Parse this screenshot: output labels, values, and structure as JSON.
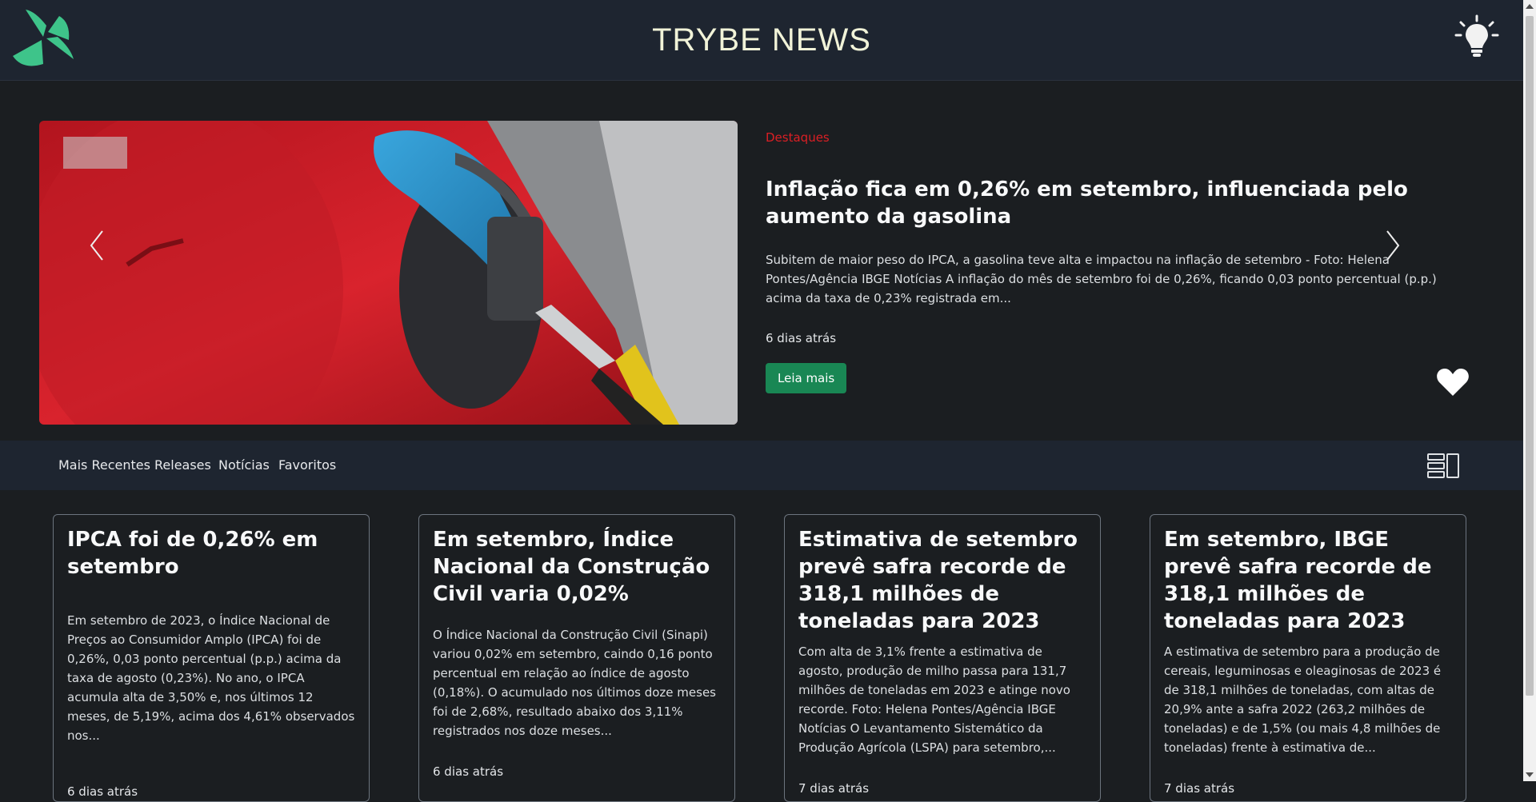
{
  "header": {
    "title": "TRYBE NEWS",
    "logo_icon": "trybe-logo-icon",
    "theme_icon": "lightbulb-icon"
  },
  "hero": {
    "category": "Destaques",
    "title": "Inflação fica em 0,26% em setembro, influenciada pelo aumento da gasolina",
    "description": "Subitem de maior peso do IPCA, a gasolina teve alta e impactou na inflação de setembro - Foto: Helena Pontes/Agência IBGE Notícias A inflação do mês de setembro foi de 0,26%, ficando 0,03 ponto percentual (p.p.) acima da taxa de 0,23% registrada em...",
    "time": "6 dias atrás",
    "button": "Leia mais",
    "favorite_icon": "heart-icon"
  },
  "nav": {
    "items": [
      {
        "label": "Mais Recentes"
      },
      {
        "label": "Releases"
      },
      {
        "label": "Notícias"
      },
      {
        "label": "Favoritos"
      }
    ],
    "layout_icon": "list-layout-icon"
  },
  "cards": [
    {
      "title": "IPCA foi de 0,26% em setembro",
      "description": "Em setembro de 2023, o Índice Nacional de Preços ao Consumidor Amplo (IPCA) foi de 0,26%, 0,03 ponto percentual (p.p.) acima da taxa de agosto (0,23%). No ano, o IPCA acumula alta de 3,50% e, nos últimos 12 meses, de 5,19%, acima dos 4,61% observados nos...",
      "time": "6 dias atrás"
    },
    {
      "title": "Em setembro, Índice Nacional da Construção Civil varia 0,02%",
      "description": "O Índice Nacional da Construção Civil (Sinapi) variou 0,02% em setembro, caindo 0,16 ponto percentual em relação ao índice de agosto (0,18%). O acumulado nos últimos doze meses foi de 2,68%, resultado abaixo dos 3,11% registrados nos doze meses...",
      "time": "6 dias atrás"
    },
    {
      "title": "Estimativa de setembro prevê safra recorde de 318,1 milhões de toneladas para 2023",
      "description": "Com alta de 3,1% frente a estimativa de agosto, produção de milho passa para 131,7 milhões de toneladas em 2023 e atinge novo recorde. Foto: Helena Pontes/Agência IBGE Notícias O Levantamento Sistemático da Produção Agrícola (LSPA) para setembro,...",
      "time": "7 dias atrás"
    },
    {
      "title": "Em setembro, IBGE prevê safra recorde de 318,1 milhões de toneladas para 2023",
      "description": "A estimativa de setembro para a produção de cereais, leguminosas e oleaginosas de 2023 é de 318,1 milhões de toneladas, com altas de 20,9% ante a safra 2022 (263,2 milhões de toneladas) e de 1,5% (ou mais 4,8 milhões de toneladas) frente à estimativa de...",
      "time": "7 dias atrás"
    }
  ],
  "colors": {
    "accent_green": "#198754",
    "category_red": "#dc1f24",
    "logo_green": "#3ec48a"
  }
}
